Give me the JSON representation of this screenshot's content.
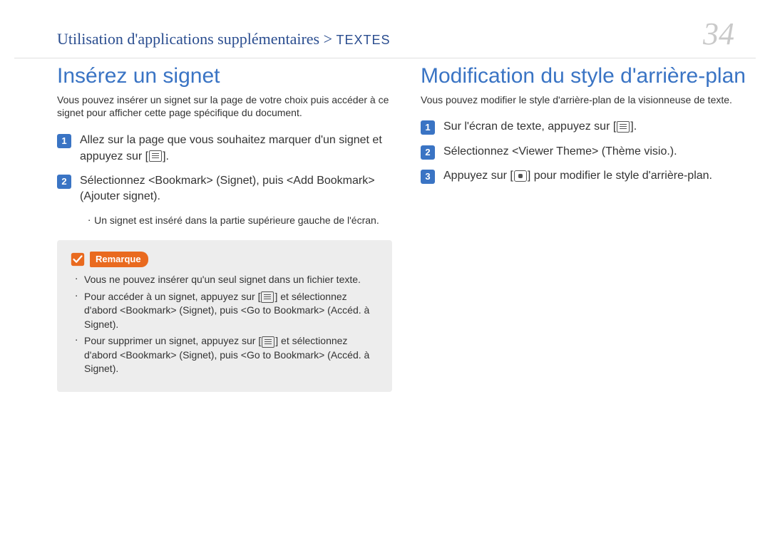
{
  "header": {
    "breadcrumb_main": "Utilisation d'applications supplémentaires",
    "breadcrumb_sep": " > ",
    "breadcrumb_sub": "TEXTES",
    "page_number": "34"
  },
  "left_column": {
    "title": "Insérez un signet",
    "intro": "Vous pouvez insérer un signet sur la page de votre choix puis accéder à ce signet pour afficher cette page spécifique du document.",
    "steps": [
      {
        "num": "1",
        "pre": "Allez sur la page que vous souhaitez marquer d'un signet et appuyez sur [",
        "post": "]."
      },
      {
        "num": "2",
        "pre": "Sélectionnez <Bookmark> (Signet), puis <Add Bookmark> (Ajouter signet).",
        "post": ""
      }
    ],
    "sub_bullet": "Un signet est inséré dans la partie supérieure gauche de l'écran.",
    "note": {
      "label": "Remarque",
      "items": [
        {
          "pre": "Vous ne pouvez insérer qu'un seul signet dans un fichier texte.",
          "icon": null,
          "post": ""
        },
        {
          "pre": "Pour accéder à un signet, appuyez sur [",
          "icon": "menu",
          "post": "] et sélectionnez d'abord <Bookmark> (Signet), puis <Go to Bookmark> (Accéd. à Signet)."
        },
        {
          "pre": "Pour supprimer un signet, appuyez sur [",
          "icon": "menu",
          "post": "] et sélectionnez d'abord <Bookmark> (Signet), puis <Go to Bookmark> (Accéd. à Signet)."
        }
      ]
    }
  },
  "right_column": {
    "title": "Modification du style d'arrière-plan",
    "intro": "Vous pouvez modifier le style d'arrière-plan de la visionneuse de texte.",
    "steps": [
      {
        "num": "1",
        "pre": "Sur l'écran de texte, appuyez sur [",
        "icon": "menu",
        "post": "]."
      },
      {
        "num": "2",
        "pre": "Sélectionnez <Viewer Theme> (Thème visio.).",
        "icon": null,
        "post": ""
      },
      {
        "num": "3",
        "pre": "Appuyez sur [",
        "icon": "center",
        "post": "] pour modifier le style d'arrière-plan."
      }
    ]
  }
}
